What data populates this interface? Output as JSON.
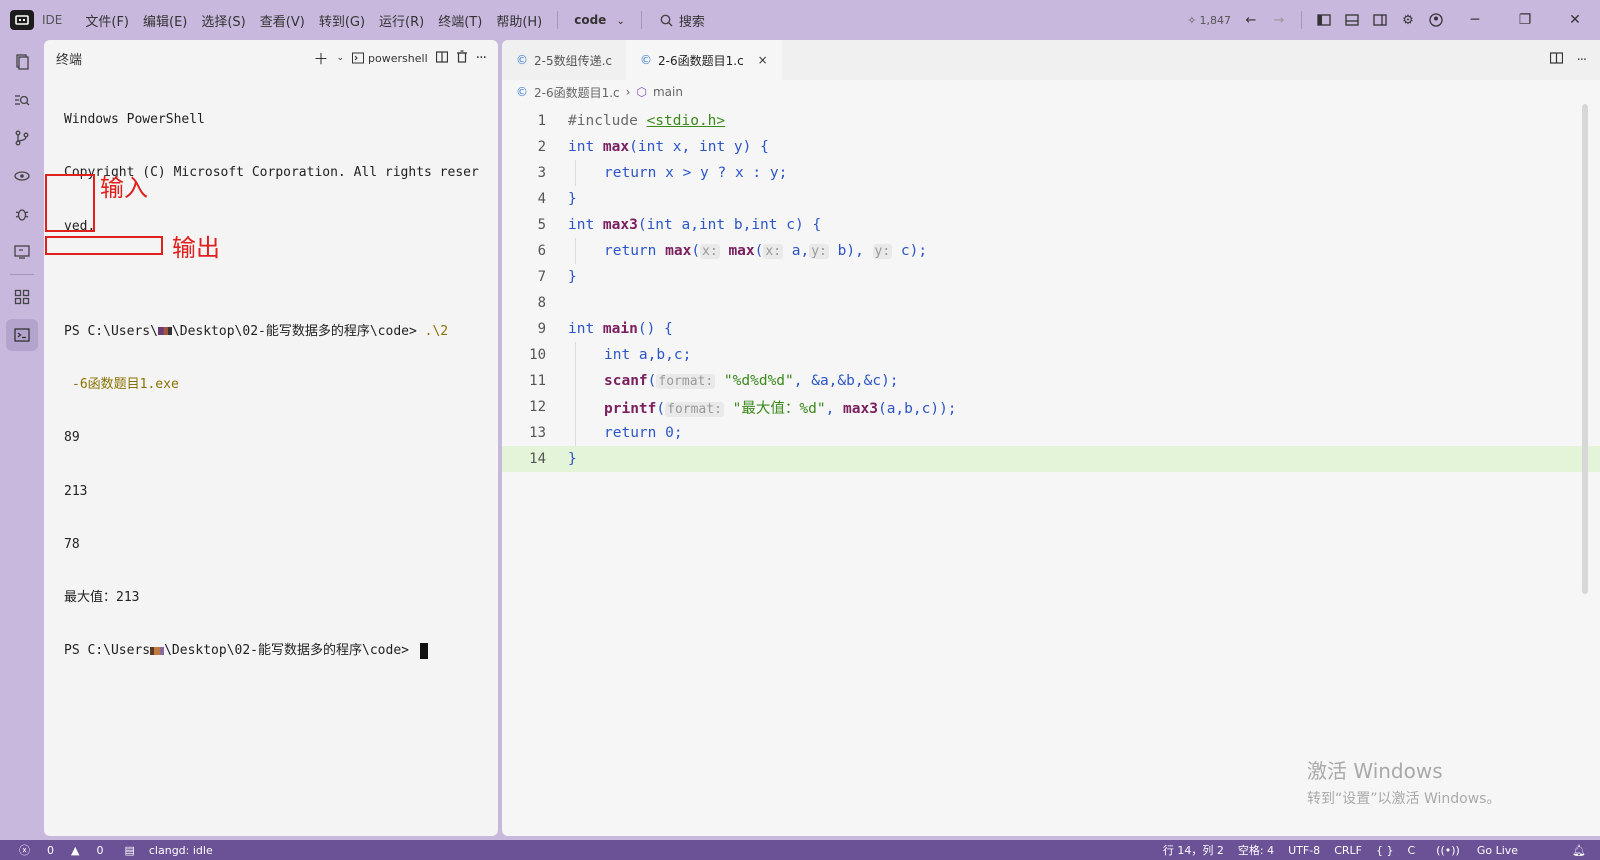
{
  "titlebar": {
    "logo": "IDE",
    "app_label": "IDE",
    "menu": [
      "文件(F)",
      "编辑(E)",
      "选择(S)",
      "查看(V)",
      "转到(G)",
      "运行(R)",
      "终端(T)",
      "帮助(H)"
    ],
    "project": "code",
    "search_label": "搜索",
    "star_count": "1,847"
  },
  "terminal": {
    "title": "终端",
    "shell_label": "powershell",
    "lines": {
      "l1": "Windows PowerShell",
      "l2": "Copyright (C) Microsoft Corporation. All rights reser",
      "l3": "ved.",
      "prompt1_a": "PS C:\\Users\\",
      "prompt1_b": "\\Desktop\\02-能写数据多的程序\\code> ",
      "cmd1": ".\\2",
      "cmd2": "-6函数题目1.exe",
      "in1": "89",
      "in2": "213",
      "in3": "78",
      "out": "最大值：213",
      "prompt2_a": "PS C:\\Users",
      "prompt2_b": "\\Desktop\\02-能写数据多的程序\\code> "
    },
    "annotations": {
      "input": "输入",
      "output": "输出"
    }
  },
  "editor": {
    "tabs": [
      {
        "label": "2-5数组传递.c"
      },
      {
        "label": "2-6函数题目1.c",
        "close": "×"
      }
    ],
    "breadcrumb": {
      "file": "2-6函数题目1.c",
      "symbol": "main"
    },
    "line_numbers": [
      "1",
      "2",
      "3",
      "4",
      "5",
      "6",
      "7",
      "8",
      "9",
      "10",
      "11",
      "12",
      "13",
      "14"
    ],
    "code": {
      "c1a": "#include ",
      "c1b": "<stdio.h>",
      "c2a": "int ",
      "c2b": "max",
      "c2c": "(",
      "c2d": "int",
      "c2e": " x, ",
      "c2f": "int",
      "c2g": " y) {",
      "c3a": "return",
      "c3b": " x > y ? x : y;",
      "c4": "}",
      "c5a": "int ",
      "c5b": "max3",
      "c5c": "(int a,int b,int c) {",
      "c6a": "return ",
      "c6b": "max",
      "c6c": "(",
      "c6h1": "x:",
      "c6d": " ",
      "c6e": "max",
      "c6f": "(",
      "c6h2": "x:",
      "c6g": " a,",
      "c6h3": "y:",
      "c6i": " b), ",
      "c6h4": "y:",
      "c6j": " c);",
      "c7": "}",
      "c9a": "int ",
      "c9b": "main",
      "c9c": "() {",
      "c10a": "int",
      "c10b": " a,b,c;",
      "c11a": "scanf",
      "c11b": "(",
      "c11h": "format:",
      "c11c": " ",
      "c11d": "\"%d%d%d\"",
      "c11e": ", &a,&b,&c);",
      "c12a": "printf",
      "c12b": "(",
      "c12h": "format:",
      "c12c": " ",
      "c12d": "\"最大值：%d\"",
      "c12e": ", ",
      "c12f": "max3",
      "c12g": "(a,b,c));",
      "c13a": "return",
      "c13b": " 0;",
      "c14": "}"
    }
  },
  "watermark": {
    "line1": "激活 Windows",
    "line2": "转到“设置”以激活 Windows。"
  },
  "statusbar": {
    "errors": "0",
    "warnings": "0",
    "lsp": "clangd: idle",
    "position": "行 14，列 2",
    "indent": "空格: 4",
    "encoding": "UTF-8",
    "eol": "CRLF",
    "braces": "{ }",
    "language": "C",
    "golive": "Go Live"
  }
}
